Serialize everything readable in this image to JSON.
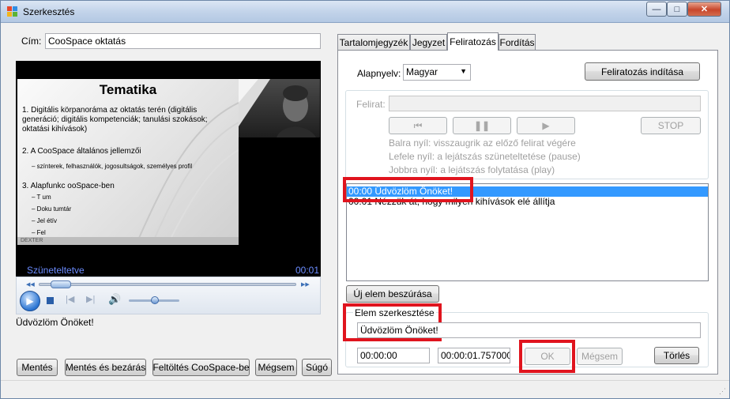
{
  "window": {
    "title": "Szerkesztés",
    "controls": {
      "minimize": "—",
      "maximize": "□",
      "close": "✕"
    }
  },
  "left": {
    "title_label": "Cím:",
    "title_value": "CooSpace oktatás",
    "video_status": "Szüneteltetve",
    "video_time": "00:01",
    "caption_preview": "Üdvözlöm Önöket!"
  },
  "slide": {
    "title": "Tematika",
    "lines": [
      "1.  Digitális körpanoráma az oktatás terén (digitális",
      "     generáció; digitális kompetenciák; tanulási szokások;",
      "     oktatási kihívások)",
      "2.  A CooSpace általános jellemzői",
      "3.  Alapfunkc          ooSpace-ben"
    ],
    "sub_items": [
      "– színterek, felhasználók, jogosultságok, személyes profil",
      "– T   um",
      "– Doku    tumtár",
      "– Jel    étív",
      "– Fel"
    ],
    "footer": "DEXTER"
  },
  "tabs": [
    "Tartalomjegyzék",
    "Jegyzet",
    "Feliratozás",
    "Fordítás"
  ],
  "active_tab": "Feliratozás",
  "captioning": {
    "base_language_label": "Alapnyelv:",
    "base_language_value": "Magyar",
    "start_button": "Feliratozás indítása",
    "caption_label": "Felirat:",
    "stop_button": "STOP",
    "hints": [
      "Balra nyíl: visszaugrik az előző felirat végére",
      "Lefele nyíl: a lejátszás szüneteltetése (pause)",
      "Jobbra nyíl: a lejátszás folytatása (play)"
    ],
    "items": [
      "00:00 Üdvözlöm Önöket!",
      "00:01 Nézzük át, hogy milyen kihívások elé állítja"
    ],
    "insert_button": "Új elem beszúrása",
    "edit_group_label": "Elem szerkesztése",
    "edit_text": "Üdvözlöm Önöket!",
    "start_time": "00:00:00",
    "end_time": "00:00:01.7570000",
    "ok_button": "OK",
    "cancel_button": "Mégsem",
    "delete_button": "Törlés"
  },
  "bottom_buttons": {
    "save": "Mentés",
    "save_close": "Mentés és bezárás",
    "upload": "Feltöltés CooSpace-be",
    "cancel": "Mégsem",
    "help": "Súgó"
  },
  "colors": {
    "selection": "#3399ff",
    "highlight_box": "#e0141e",
    "video_text": "#6b8cff"
  }
}
